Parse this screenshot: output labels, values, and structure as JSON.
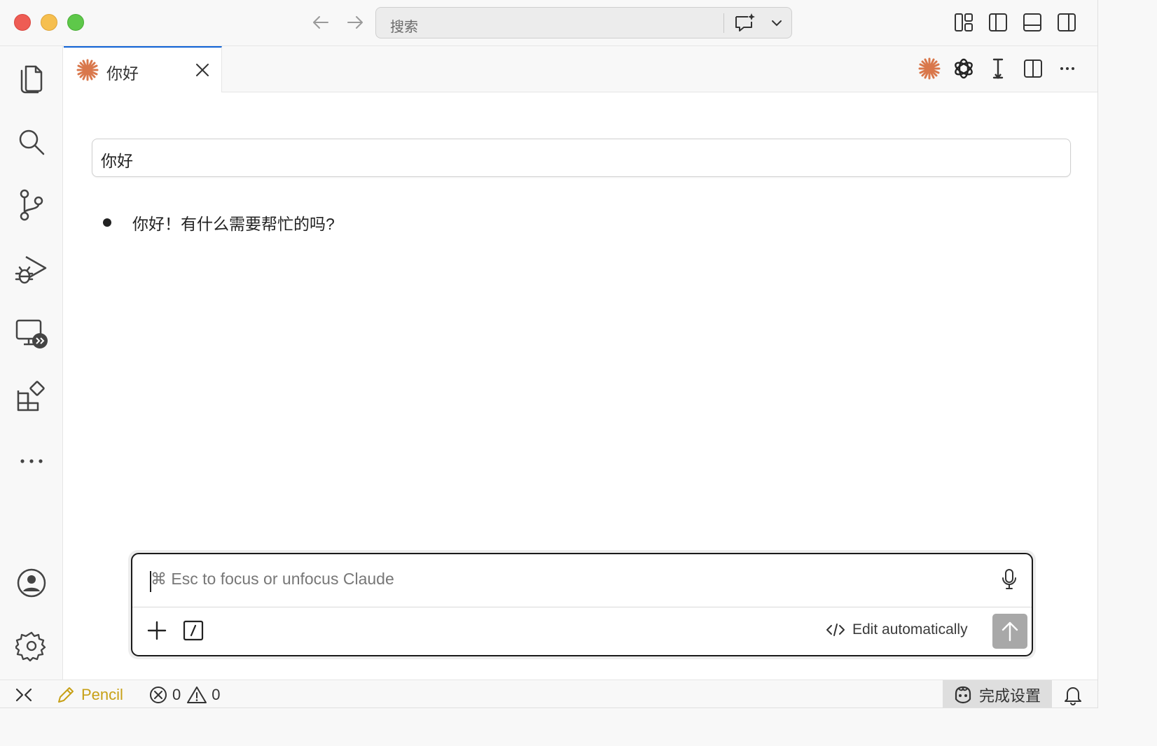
{
  "titlebar": {
    "search_placeholder": "搜索",
    "icons": [
      "back-arrow-icon",
      "forward-arrow-icon",
      "chat-sparkle-icon",
      "chevron-down-icon",
      "layout-customize-icon",
      "toggle-primary-sidebar-icon",
      "toggle-panel-icon",
      "toggle-secondary-sidebar-icon"
    ]
  },
  "activitybar": {
    "items": [
      "explorer",
      "search",
      "source-control",
      "run-and-debug",
      "remote-explorer",
      "extensions",
      "more"
    ],
    "bottom": [
      "accounts",
      "manage"
    ]
  },
  "tab": {
    "label": "你好",
    "icon": "claude-icon"
  },
  "editor_actions": [
    "claude-icon",
    "openai-icon",
    "text-cursor-icon",
    "split-editor-icon",
    "more-actions-icon"
  ],
  "conversation": {
    "user_message": "你好",
    "assistant_reply": "你好！有什么需要帮忙的吗?"
  },
  "composer": {
    "placeholder": "⌘ Esc to focus or unfocus Claude",
    "mode_label": "Edit automatically"
  },
  "statusbar": {
    "pencil_label": "Pencil",
    "errors": "0",
    "warnings": "0",
    "setup_label": "完成设置"
  },
  "colors": {
    "claude_accent": "#d9774b",
    "tab_active_border": "#0f62d6",
    "pencil_yellow": "#c7a016",
    "send_disabled": "#a8a8a8"
  }
}
